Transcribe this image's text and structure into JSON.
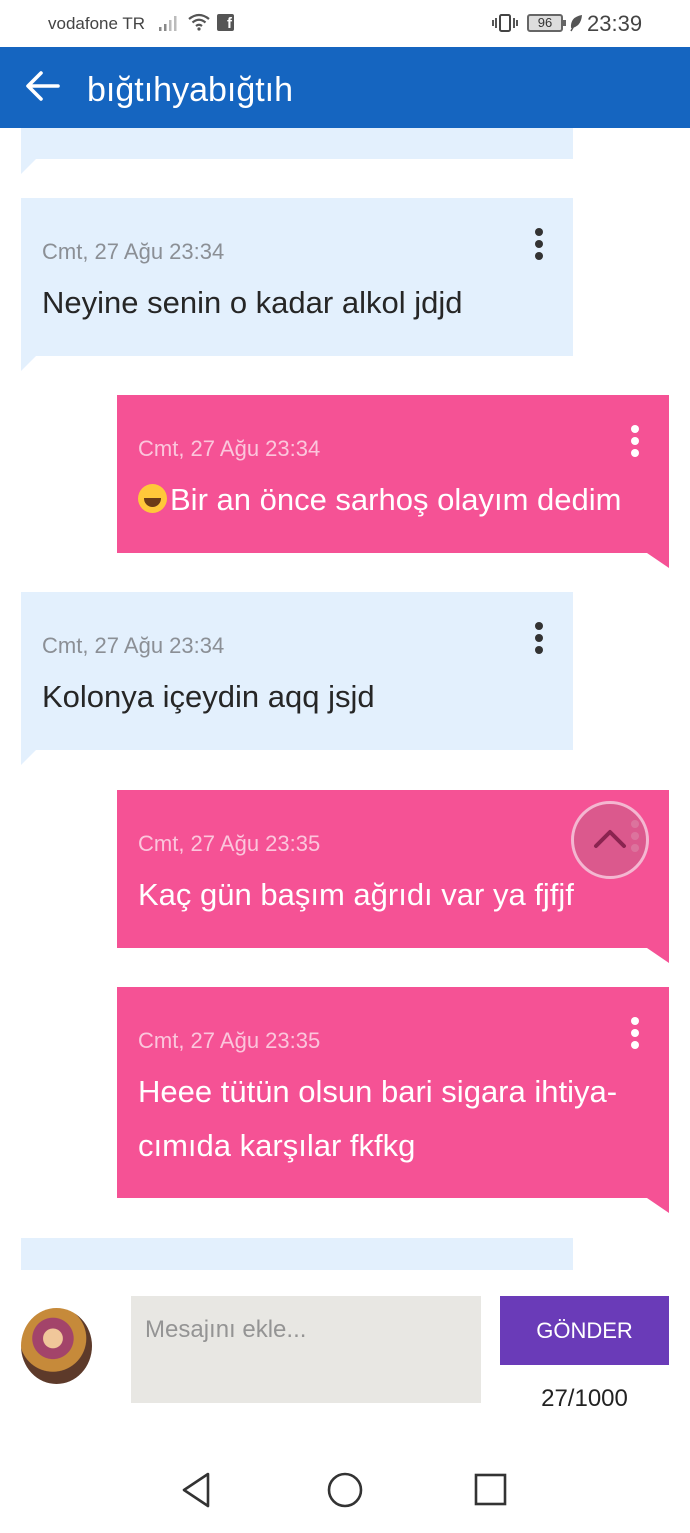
{
  "status_bar": {
    "carrier": "vodafone TR",
    "battery": "96",
    "time": "23:39"
  },
  "app_bar": {
    "title": "bığtıhyabığtıh"
  },
  "messages": [
    {
      "direction": "incoming",
      "timestamp": "",
      "text": ""
    },
    {
      "direction": "incoming",
      "timestamp": "Cmt, 27 Ağu 23:34",
      "text": "Neyine senin o kadar alkol jdjd"
    },
    {
      "direction": "outgoing",
      "timestamp": "Cmt, 27 Ağu 23:34",
      "emoji": "grinning-face",
      "text": "Bir an önce sarhoş olayım dedim"
    },
    {
      "direction": "incoming",
      "timestamp": "Cmt, 27 Ağu 23:34",
      "text": "Kolonya içeydin aqq jsjd"
    },
    {
      "direction": "outgoing",
      "timestamp": "Cmt, 27 Ağu 23:35",
      "text": "Kaç gün başım ağrıdı var ya fjfjf"
    },
    {
      "direction": "outgoing",
      "timestamp": "Cmt, 27 Ağu 23:35",
      "text": "Heee tütün olsun bari sigara ihtiya-cımıda karşılar fkfkg"
    },
    {
      "direction": "incoming",
      "timestamp": "",
      "text": ""
    }
  ],
  "composer": {
    "placeholder": "Mesajını ekle...",
    "send_label": "GÖNDER",
    "counter": "27/1000"
  },
  "colors": {
    "app_bar": "#1565c0",
    "incoming_bubble": "#e3f0fd",
    "outgoing_bubble": "#f55295",
    "send_button": "#6a3bb8"
  }
}
